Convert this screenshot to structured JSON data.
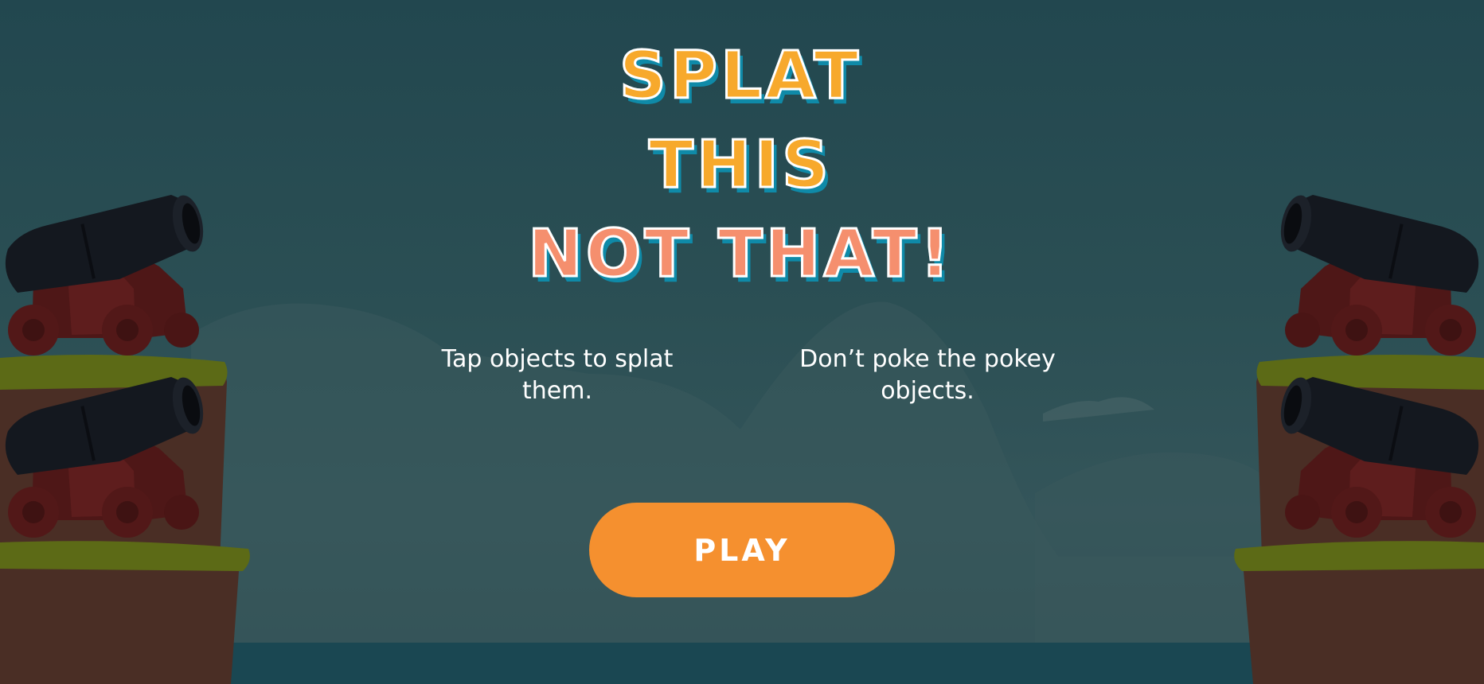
{
  "game": {
    "title_line1": "SPLAT THIS",
    "title_line2": "NOT THAT!",
    "instruction_left": "Tap objects to splat them.",
    "instruction_right": "Don’t poke the pokey objects.",
    "play_label": "PLAY"
  },
  "colors": {
    "background": "#2b4f54",
    "title_orange": "#f7a92c",
    "title_salmon": "#f58f6e",
    "title_shadow": "#0f8aa8",
    "play_button": "#f5902f",
    "cannon_barrel": "#14181f",
    "cannon_carriage": "#5a1a1a",
    "grass": "#5c6a16",
    "cliff": "#4a2e25",
    "water": "#1a4752"
  },
  "icons": [
    "cannon-icon"
  ]
}
